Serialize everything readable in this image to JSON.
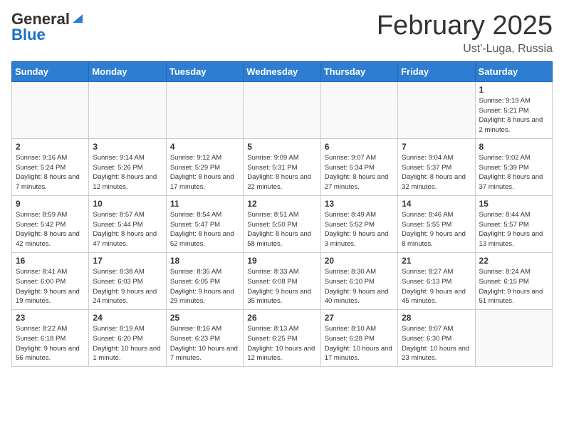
{
  "header": {
    "logo_general": "General",
    "logo_blue": "Blue",
    "title": "February 2025",
    "location": "Ust'-Luga, Russia"
  },
  "weekdays": [
    "Sunday",
    "Monday",
    "Tuesday",
    "Wednesday",
    "Thursday",
    "Friday",
    "Saturday"
  ],
  "weeks": [
    [
      {
        "day": "",
        "info": ""
      },
      {
        "day": "",
        "info": ""
      },
      {
        "day": "",
        "info": ""
      },
      {
        "day": "",
        "info": ""
      },
      {
        "day": "",
        "info": ""
      },
      {
        "day": "",
        "info": ""
      },
      {
        "day": "1",
        "info": "Sunrise: 9:19 AM\nSunset: 5:21 PM\nDaylight: 8 hours and 2 minutes."
      }
    ],
    [
      {
        "day": "2",
        "info": "Sunrise: 9:16 AM\nSunset: 5:24 PM\nDaylight: 8 hours and 7 minutes."
      },
      {
        "day": "3",
        "info": "Sunrise: 9:14 AM\nSunset: 5:26 PM\nDaylight: 8 hours and 12 minutes."
      },
      {
        "day": "4",
        "info": "Sunrise: 9:12 AM\nSunset: 5:29 PM\nDaylight: 8 hours and 17 minutes."
      },
      {
        "day": "5",
        "info": "Sunrise: 9:09 AM\nSunset: 5:31 PM\nDaylight: 8 hours and 22 minutes."
      },
      {
        "day": "6",
        "info": "Sunrise: 9:07 AM\nSunset: 5:34 PM\nDaylight: 8 hours and 27 minutes."
      },
      {
        "day": "7",
        "info": "Sunrise: 9:04 AM\nSunset: 5:37 PM\nDaylight: 8 hours and 32 minutes."
      },
      {
        "day": "8",
        "info": "Sunrise: 9:02 AM\nSunset: 5:39 PM\nDaylight: 8 hours and 37 minutes."
      }
    ],
    [
      {
        "day": "9",
        "info": "Sunrise: 8:59 AM\nSunset: 5:42 PM\nDaylight: 8 hours and 42 minutes."
      },
      {
        "day": "10",
        "info": "Sunrise: 8:57 AM\nSunset: 5:44 PM\nDaylight: 8 hours and 47 minutes."
      },
      {
        "day": "11",
        "info": "Sunrise: 8:54 AM\nSunset: 5:47 PM\nDaylight: 8 hours and 52 minutes."
      },
      {
        "day": "12",
        "info": "Sunrise: 8:51 AM\nSunset: 5:50 PM\nDaylight: 8 hours and 58 minutes."
      },
      {
        "day": "13",
        "info": "Sunrise: 8:49 AM\nSunset: 5:52 PM\nDaylight: 9 hours and 3 minutes."
      },
      {
        "day": "14",
        "info": "Sunrise: 8:46 AM\nSunset: 5:55 PM\nDaylight: 9 hours and 8 minutes."
      },
      {
        "day": "15",
        "info": "Sunrise: 8:44 AM\nSunset: 5:57 PM\nDaylight: 9 hours and 13 minutes."
      }
    ],
    [
      {
        "day": "16",
        "info": "Sunrise: 8:41 AM\nSunset: 6:00 PM\nDaylight: 9 hours and 19 minutes."
      },
      {
        "day": "17",
        "info": "Sunrise: 8:38 AM\nSunset: 6:03 PM\nDaylight: 9 hours and 24 minutes."
      },
      {
        "day": "18",
        "info": "Sunrise: 8:35 AM\nSunset: 6:05 PM\nDaylight: 9 hours and 29 minutes."
      },
      {
        "day": "19",
        "info": "Sunrise: 8:33 AM\nSunset: 6:08 PM\nDaylight: 9 hours and 35 minutes."
      },
      {
        "day": "20",
        "info": "Sunrise: 8:30 AM\nSunset: 6:10 PM\nDaylight: 9 hours and 40 minutes."
      },
      {
        "day": "21",
        "info": "Sunrise: 8:27 AM\nSunset: 6:13 PM\nDaylight: 9 hours and 45 minutes."
      },
      {
        "day": "22",
        "info": "Sunrise: 8:24 AM\nSunset: 6:15 PM\nDaylight: 9 hours and 51 minutes."
      }
    ],
    [
      {
        "day": "23",
        "info": "Sunrise: 8:22 AM\nSunset: 6:18 PM\nDaylight: 9 hours and 56 minutes."
      },
      {
        "day": "24",
        "info": "Sunrise: 8:19 AM\nSunset: 6:20 PM\nDaylight: 10 hours and 1 minute."
      },
      {
        "day": "25",
        "info": "Sunrise: 8:16 AM\nSunset: 6:23 PM\nDaylight: 10 hours and 7 minutes."
      },
      {
        "day": "26",
        "info": "Sunrise: 8:13 AM\nSunset: 6:25 PM\nDaylight: 10 hours and 12 minutes."
      },
      {
        "day": "27",
        "info": "Sunrise: 8:10 AM\nSunset: 6:28 PM\nDaylight: 10 hours and 17 minutes."
      },
      {
        "day": "28",
        "info": "Sunrise: 8:07 AM\nSunset: 6:30 PM\nDaylight: 10 hours and 23 minutes."
      },
      {
        "day": "",
        "info": ""
      }
    ]
  ]
}
